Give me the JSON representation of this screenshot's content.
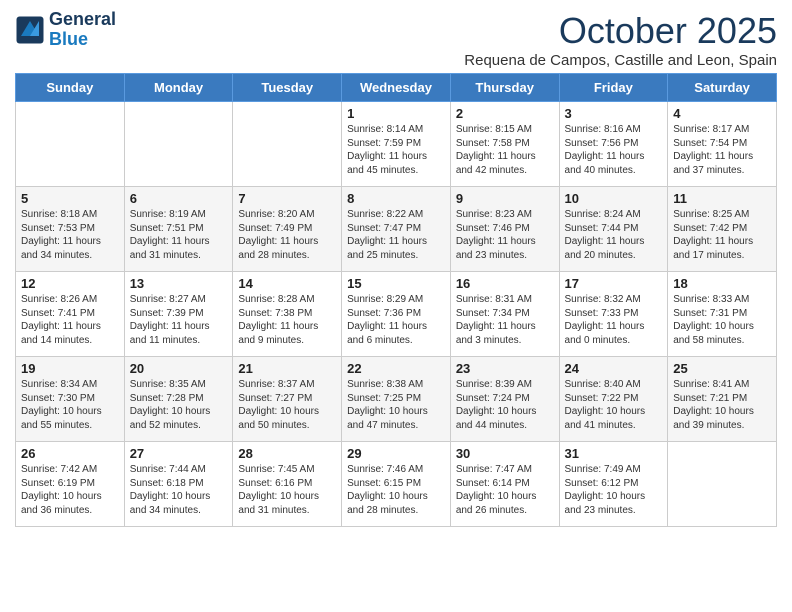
{
  "header": {
    "logo_line1": "General",
    "logo_line2": "Blue",
    "month": "October 2025",
    "location": "Requena de Campos, Castille and Leon, Spain"
  },
  "weekdays": [
    "Sunday",
    "Monday",
    "Tuesday",
    "Wednesday",
    "Thursday",
    "Friday",
    "Saturday"
  ],
  "weeks": [
    [
      {
        "day": "",
        "info": ""
      },
      {
        "day": "",
        "info": ""
      },
      {
        "day": "",
        "info": ""
      },
      {
        "day": "1",
        "info": "Sunrise: 8:14 AM\nSunset: 7:59 PM\nDaylight: 11 hours\nand 45 minutes."
      },
      {
        "day": "2",
        "info": "Sunrise: 8:15 AM\nSunset: 7:58 PM\nDaylight: 11 hours\nand 42 minutes."
      },
      {
        "day": "3",
        "info": "Sunrise: 8:16 AM\nSunset: 7:56 PM\nDaylight: 11 hours\nand 40 minutes."
      },
      {
        "day": "4",
        "info": "Sunrise: 8:17 AM\nSunset: 7:54 PM\nDaylight: 11 hours\nand 37 minutes."
      }
    ],
    [
      {
        "day": "5",
        "info": "Sunrise: 8:18 AM\nSunset: 7:53 PM\nDaylight: 11 hours\nand 34 minutes."
      },
      {
        "day": "6",
        "info": "Sunrise: 8:19 AM\nSunset: 7:51 PM\nDaylight: 11 hours\nand 31 minutes."
      },
      {
        "day": "7",
        "info": "Sunrise: 8:20 AM\nSunset: 7:49 PM\nDaylight: 11 hours\nand 28 minutes."
      },
      {
        "day": "8",
        "info": "Sunrise: 8:22 AM\nSunset: 7:47 PM\nDaylight: 11 hours\nand 25 minutes."
      },
      {
        "day": "9",
        "info": "Sunrise: 8:23 AM\nSunset: 7:46 PM\nDaylight: 11 hours\nand 23 minutes."
      },
      {
        "day": "10",
        "info": "Sunrise: 8:24 AM\nSunset: 7:44 PM\nDaylight: 11 hours\nand 20 minutes."
      },
      {
        "day": "11",
        "info": "Sunrise: 8:25 AM\nSunset: 7:42 PM\nDaylight: 11 hours\nand 17 minutes."
      }
    ],
    [
      {
        "day": "12",
        "info": "Sunrise: 8:26 AM\nSunset: 7:41 PM\nDaylight: 11 hours\nand 14 minutes."
      },
      {
        "day": "13",
        "info": "Sunrise: 8:27 AM\nSunset: 7:39 PM\nDaylight: 11 hours\nand 11 minutes."
      },
      {
        "day": "14",
        "info": "Sunrise: 8:28 AM\nSunset: 7:38 PM\nDaylight: 11 hours\nand 9 minutes."
      },
      {
        "day": "15",
        "info": "Sunrise: 8:29 AM\nSunset: 7:36 PM\nDaylight: 11 hours\nand 6 minutes."
      },
      {
        "day": "16",
        "info": "Sunrise: 8:31 AM\nSunset: 7:34 PM\nDaylight: 11 hours\nand 3 minutes."
      },
      {
        "day": "17",
        "info": "Sunrise: 8:32 AM\nSunset: 7:33 PM\nDaylight: 11 hours\nand 0 minutes."
      },
      {
        "day": "18",
        "info": "Sunrise: 8:33 AM\nSunset: 7:31 PM\nDaylight: 10 hours\nand 58 minutes."
      }
    ],
    [
      {
        "day": "19",
        "info": "Sunrise: 8:34 AM\nSunset: 7:30 PM\nDaylight: 10 hours\nand 55 minutes."
      },
      {
        "day": "20",
        "info": "Sunrise: 8:35 AM\nSunset: 7:28 PM\nDaylight: 10 hours\nand 52 minutes."
      },
      {
        "day": "21",
        "info": "Sunrise: 8:37 AM\nSunset: 7:27 PM\nDaylight: 10 hours\nand 50 minutes."
      },
      {
        "day": "22",
        "info": "Sunrise: 8:38 AM\nSunset: 7:25 PM\nDaylight: 10 hours\nand 47 minutes."
      },
      {
        "day": "23",
        "info": "Sunrise: 8:39 AM\nSunset: 7:24 PM\nDaylight: 10 hours\nand 44 minutes."
      },
      {
        "day": "24",
        "info": "Sunrise: 8:40 AM\nSunset: 7:22 PM\nDaylight: 10 hours\nand 41 minutes."
      },
      {
        "day": "25",
        "info": "Sunrise: 8:41 AM\nSunset: 7:21 PM\nDaylight: 10 hours\nand 39 minutes."
      }
    ],
    [
      {
        "day": "26",
        "info": "Sunrise: 7:42 AM\nSunset: 6:19 PM\nDaylight: 10 hours\nand 36 minutes."
      },
      {
        "day": "27",
        "info": "Sunrise: 7:44 AM\nSunset: 6:18 PM\nDaylight: 10 hours\nand 34 minutes."
      },
      {
        "day": "28",
        "info": "Sunrise: 7:45 AM\nSunset: 6:16 PM\nDaylight: 10 hours\nand 31 minutes."
      },
      {
        "day": "29",
        "info": "Sunrise: 7:46 AM\nSunset: 6:15 PM\nDaylight: 10 hours\nand 28 minutes."
      },
      {
        "day": "30",
        "info": "Sunrise: 7:47 AM\nSunset: 6:14 PM\nDaylight: 10 hours\nand 26 minutes."
      },
      {
        "day": "31",
        "info": "Sunrise: 7:49 AM\nSunset: 6:12 PM\nDaylight: 10 hours\nand 23 minutes."
      },
      {
        "day": "",
        "info": ""
      }
    ]
  ]
}
